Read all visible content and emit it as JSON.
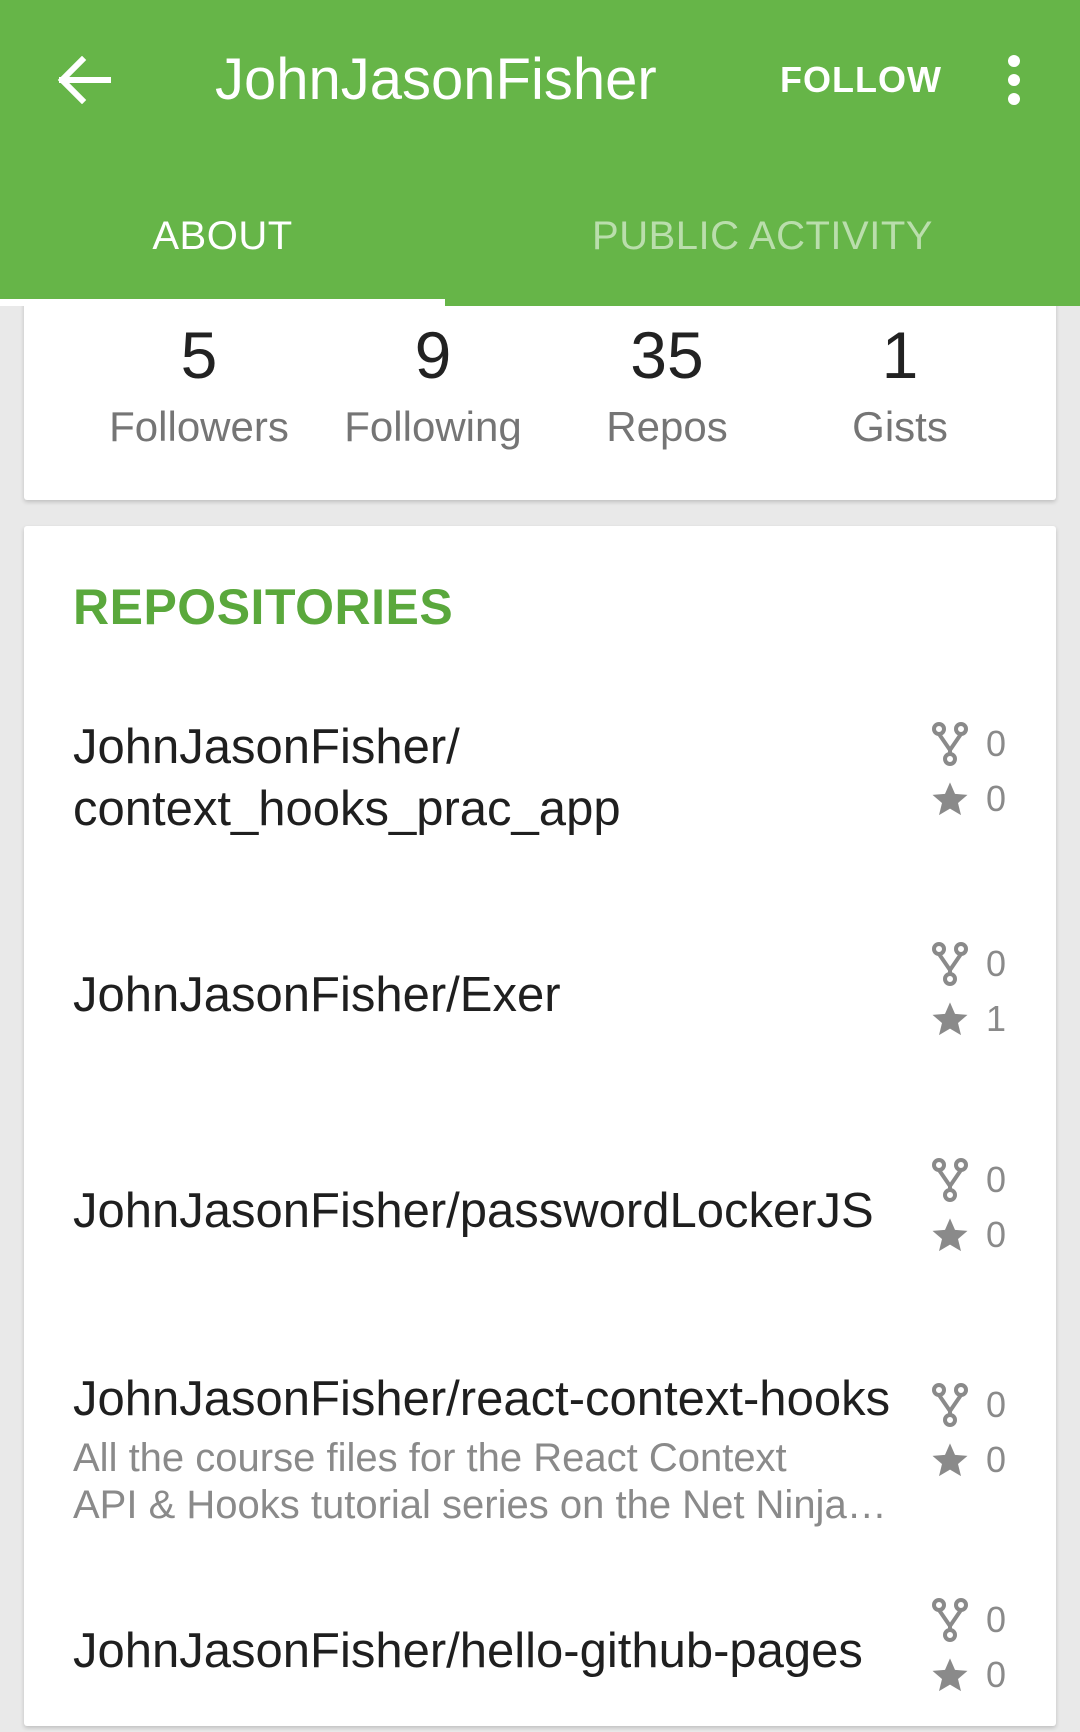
{
  "appbar": {
    "title": "JohnJasonFisher",
    "follow_label": "FOLLOW",
    "back_icon": "arrow-left-icon",
    "more_icon": "more-vert-icon",
    "color": "#66b548"
  },
  "tabs": [
    {
      "label": "ABOUT",
      "active": true
    },
    {
      "label": "PUBLIC ACTIVITY",
      "active": false
    }
  ],
  "stats": [
    {
      "value": "5",
      "label": "Followers"
    },
    {
      "value": "9",
      "label": "Following"
    },
    {
      "value": "35",
      "label": "Repos"
    },
    {
      "value": "1",
      "label": "Gists"
    }
  ],
  "repositories": {
    "header": "REPOSITORIES",
    "header_color": "#5aa83c",
    "items": [
      {
        "name_line1": "JohnJasonFisher/",
        "name_line2": "context_hooks_prac_app",
        "forks": "0",
        "stars": "0"
      },
      {
        "name": "JohnJasonFisher/Exer",
        "forks": "0",
        "stars": "1"
      },
      {
        "name": "JohnJasonFisher/passwordLockerJS",
        "forks": "0",
        "stars": "0"
      },
      {
        "name": "JohnJasonFisher/react-context-hooks",
        "desc_line1": "All the course files for the React Context",
        "desc_line2": "API & Hooks tutorial series on the Net Ninja…",
        "forks": "0",
        "stars": "0"
      },
      {
        "name": "JohnJasonFisher/hello-github-pages",
        "forks": "0",
        "stars": "0"
      }
    ]
  }
}
